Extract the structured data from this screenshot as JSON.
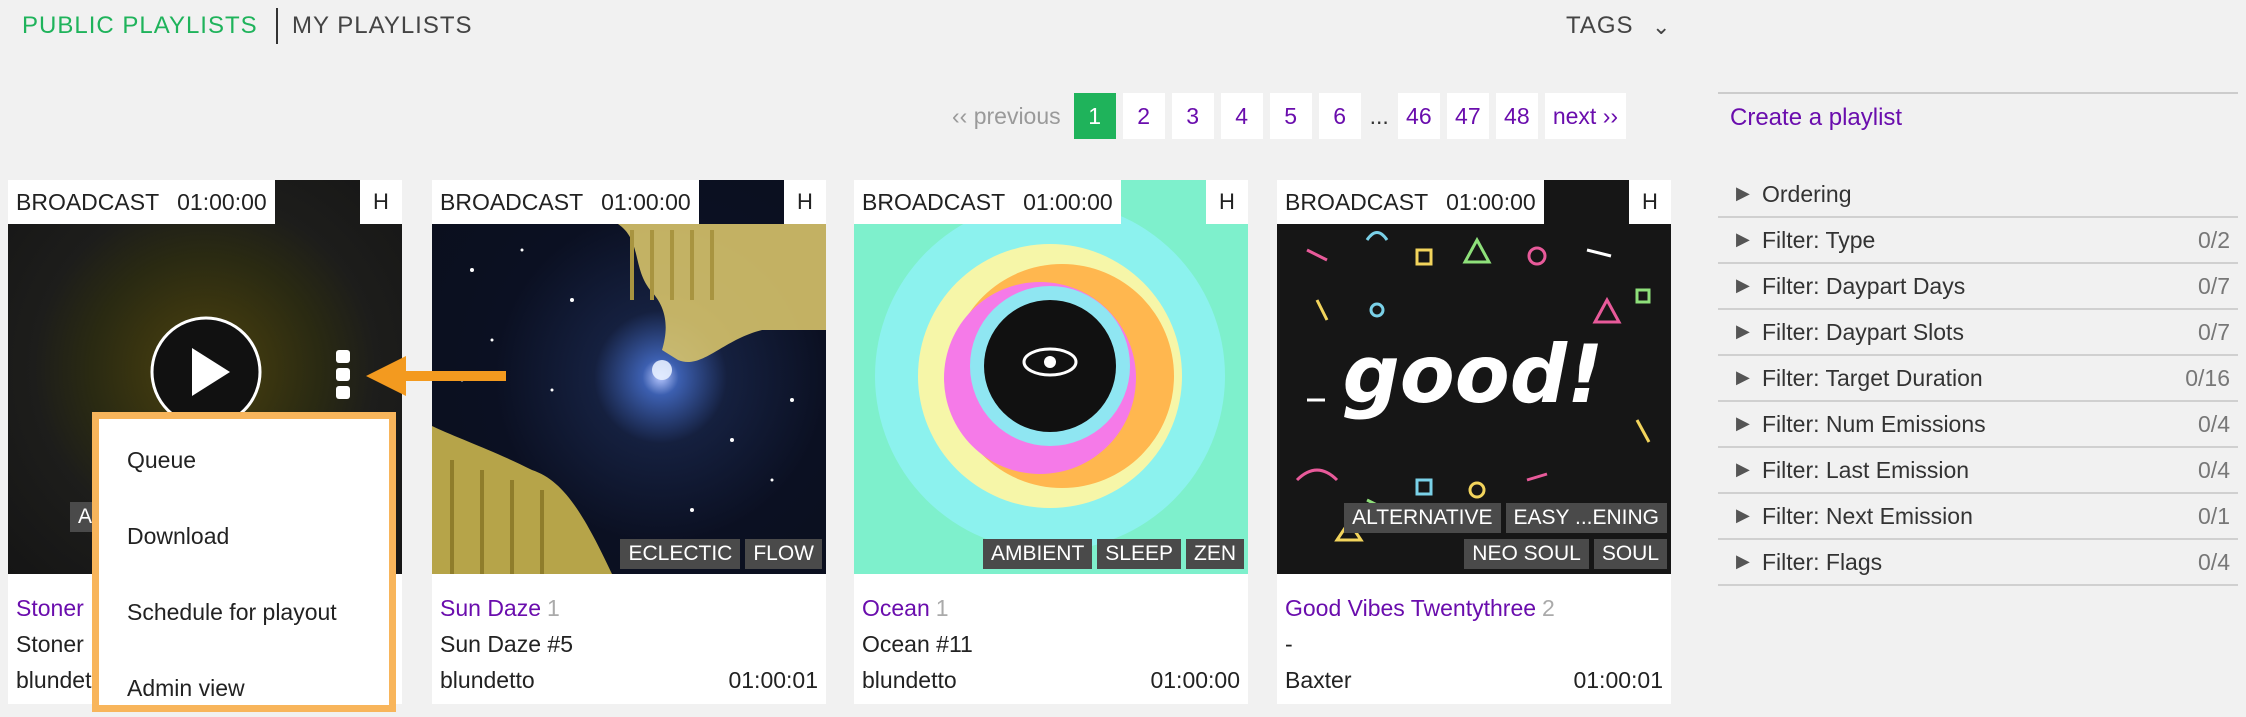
{
  "tabs": {
    "public": "PUBLIC PLAYLISTS",
    "mine": "MY PLAYLISTS",
    "tags": "TAGS"
  },
  "pagination": {
    "previous": "‹‹ previous",
    "pages": [
      "1",
      "2",
      "3",
      "4",
      "5",
      "6"
    ],
    "ellipsis": "...",
    "last_pages": [
      "46",
      "47",
      "48"
    ],
    "next": "next ››",
    "active_page": "1"
  },
  "cards": [
    {
      "broadcast": "BROADCAST",
      "time": "01:00:00",
      "badge": "H",
      "title": "Stoner",
      "count": "",
      "subtitle": "Stoner",
      "owner": "blundet",
      "duration": "",
      "tags_row1": [],
      "tags_row2": [
        "A"
      ]
    },
    {
      "broadcast": "BROADCAST",
      "time": "01:00:00",
      "badge": "H",
      "title": "Sun Daze",
      "count": "1",
      "subtitle": "Sun Daze #5",
      "owner": "blundetto",
      "duration": "01:00:01",
      "tags_row1": [],
      "tags_row2": [
        "ECLECTIC",
        "FLOW"
      ]
    },
    {
      "broadcast": "BROADCAST",
      "time": "01:00:00",
      "badge": "H",
      "title": "Ocean",
      "count": "1",
      "subtitle": "Ocean #11",
      "owner": "blundetto",
      "duration": "01:00:00",
      "tags_row1": [],
      "tags_row2": [
        "AMBIENT",
        "SLEEP",
        "ZEN"
      ]
    },
    {
      "broadcast": "BROADCAST",
      "time": "01:00:00",
      "badge": "H",
      "title": "Good Vibes Twentythree",
      "count": "2",
      "subtitle": "-",
      "owner": "Baxter",
      "duration": "01:00:01",
      "tags_row1": [
        "ALTERNATIVE",
        "EASY ...ENING"
      ],
      "tags_row2": [
        "NEO SOUL",
        "SOUL"
      ],
      "art_text": "good!"
    }
  ],
  "menu": {
    "items": [
      "Queue",
      "Download",
      "Schedule for playout",
      "Admin view"
    ]
  },
  "sidebar": {
    "create": "Create a playlist",
    "filters": [
      {
        "label": "Ordering",
        "count": ""
      },
      {
        "label": "Filter: Type",
        "count": "0/2"
      },
      {
        "label": "Filter: Daypart Days",
        "count": "0/7"
      },
      {
        "label": "Filter: Daypart Slots",
        "count": "0/7"
      },
      {
        "label": "Filter: Target Duration",
        "count": "0/16"
      },
      {
        "label": "Filter: Num Emissions",
        "count": "0/4"
      },
      {
        "label": "Filter: Last Emission",
        "count": "0/4"
      },
      {
        "label": "Filter: Next Emission",
        "count": "0/1"
      },
      {
        "label": "Filter: Flags",
        "count": "0/4"
      }
    ]
  },
  "colors": {
    "accent_green": "#1fb35b",
    "link_purple": "#6a0dad",
    "highlight_orange": "#f8b55b",
    "arrow_orange": "#f39a1f"
  },
  "icons": {
    "play": "play-icon",
    "more": "kebab-menu-icon",
    "arrow": "arrow-left-icon",
    "collapse": "triangle-right-icon",
    "tags_dropdown": "chevron-down-icon"
  }
}
